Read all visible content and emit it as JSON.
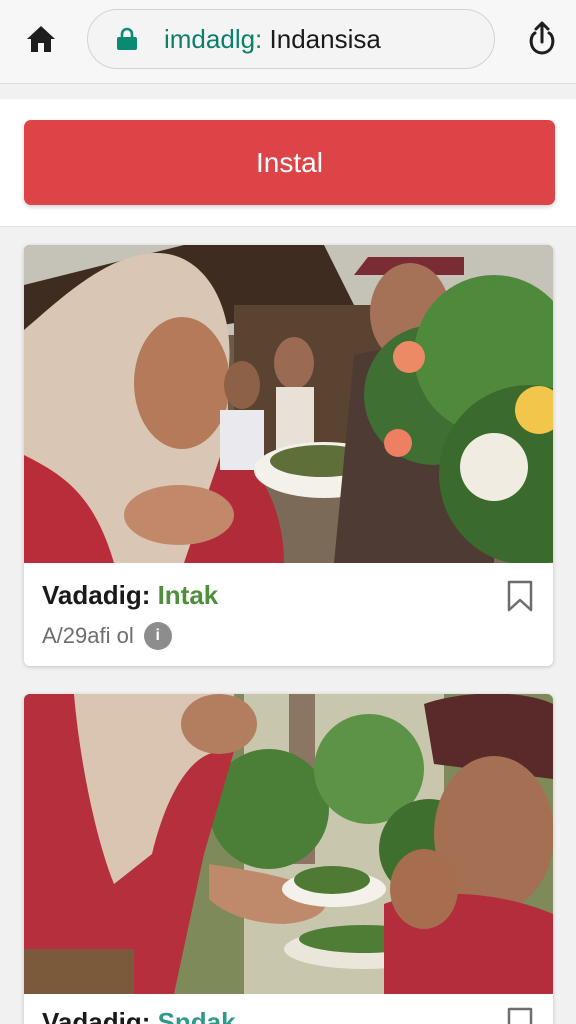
{
  "browser": {
    "url_host": "imdadlg:",
    "url_path": " Indansisa",
    "icons": {
      "home": "home-icon",
      "lock": "lock-icon",
      "share": "share-icon"
    },
    "host_color": "#0b7f6b"
  },
  "install": {
    "label": "Instal",
    "color": "#dc4447"
  },
  "cards": [
    {
      "title_prefix": "Vadadig: ",
      "title_highlight": "Intak",
      "highlight_color": "#4d8f3b",
      "meta": "A/29afi ol",
      "info_badge": "i",
      "bookmark_icon": "bookmark-icon"
    },
    {
      "title_prefix": "Vadadig: ",
      "title_highlight": "Sndak",
      "highlight_color": "#2f9a8a",
      "bookmark_icon": "bookmark-icon"
    }
  ]
}
